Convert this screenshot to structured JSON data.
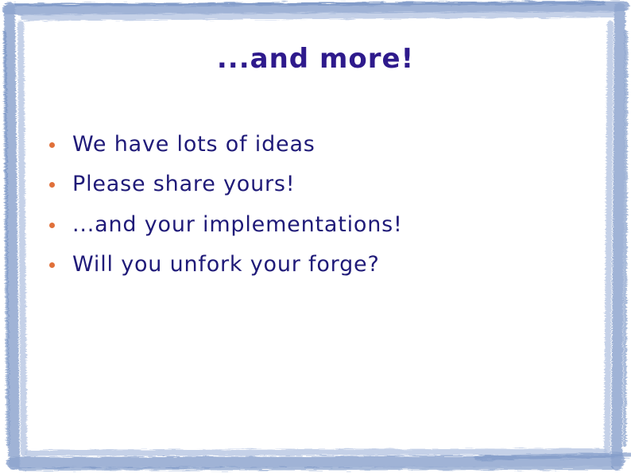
{
  "slide": {
    "title": "...and more!",
    "bullets": [
      "We have lots of ideas",
      "Please share yours!",
      "...and your implementations!",
      "Will you unfork your forge?"
    ]
  },
  "colors": {
    "title": "#2e1a8c",
    "text": "#1f1a78",
    "bullet": "#e0703a",
    "frame": "#8fa6cf"
  }
}
